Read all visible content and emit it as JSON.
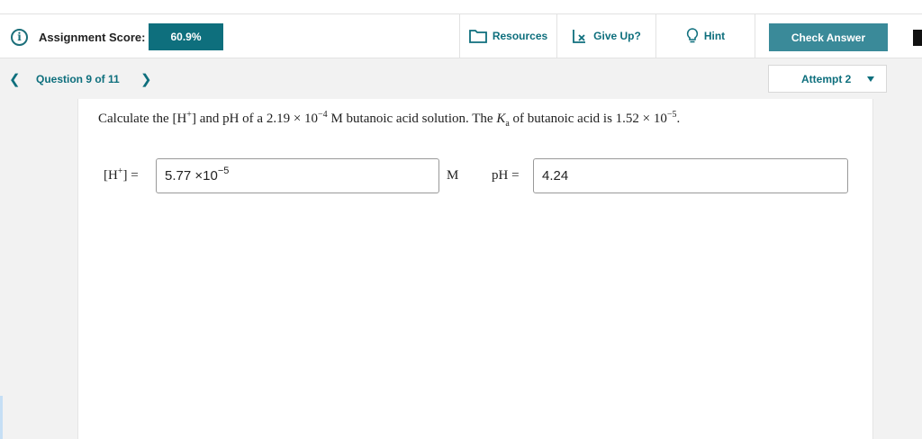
{
  "toolbar": {
    "score_label": "Assignment Score:",
    "score_value": "60.9%",
    "resources_label": "Resources",
    "giveup_label": "Give Up?",
    "hint_label": "Hint",
    "check_label": "Check Answer"
  },
  "nav": {
    "question_label": "Question 9 of 11",
    "attempt_label": "Attempt 2"
  },
  "question": {
    "t1": "Calculate the ",
    "t2": " and pH of a 2.19 × 10",
    "exp1": "−4",
    "t3": " M butanoic acid solution. The ",
    "ka_k": "K",
    "ka_sub": "a",
    "t4": " of butanoic acid is 1.52 × 10",
    "exp2": "−5",
    "t5": "."
  },
  "answers": {
    "h_label_eq": "=",
    "h_value_mantissa": "5.77 ×10",
    "h_value_exp": "−5",
    "h_unit": "M",
    "ph_label": "pH =",
    "ph_value": "4.24"
  },
  "colors": {
    "accent": "#0e6f7d",
    "check_button": "#3a8a99"
  }
}
